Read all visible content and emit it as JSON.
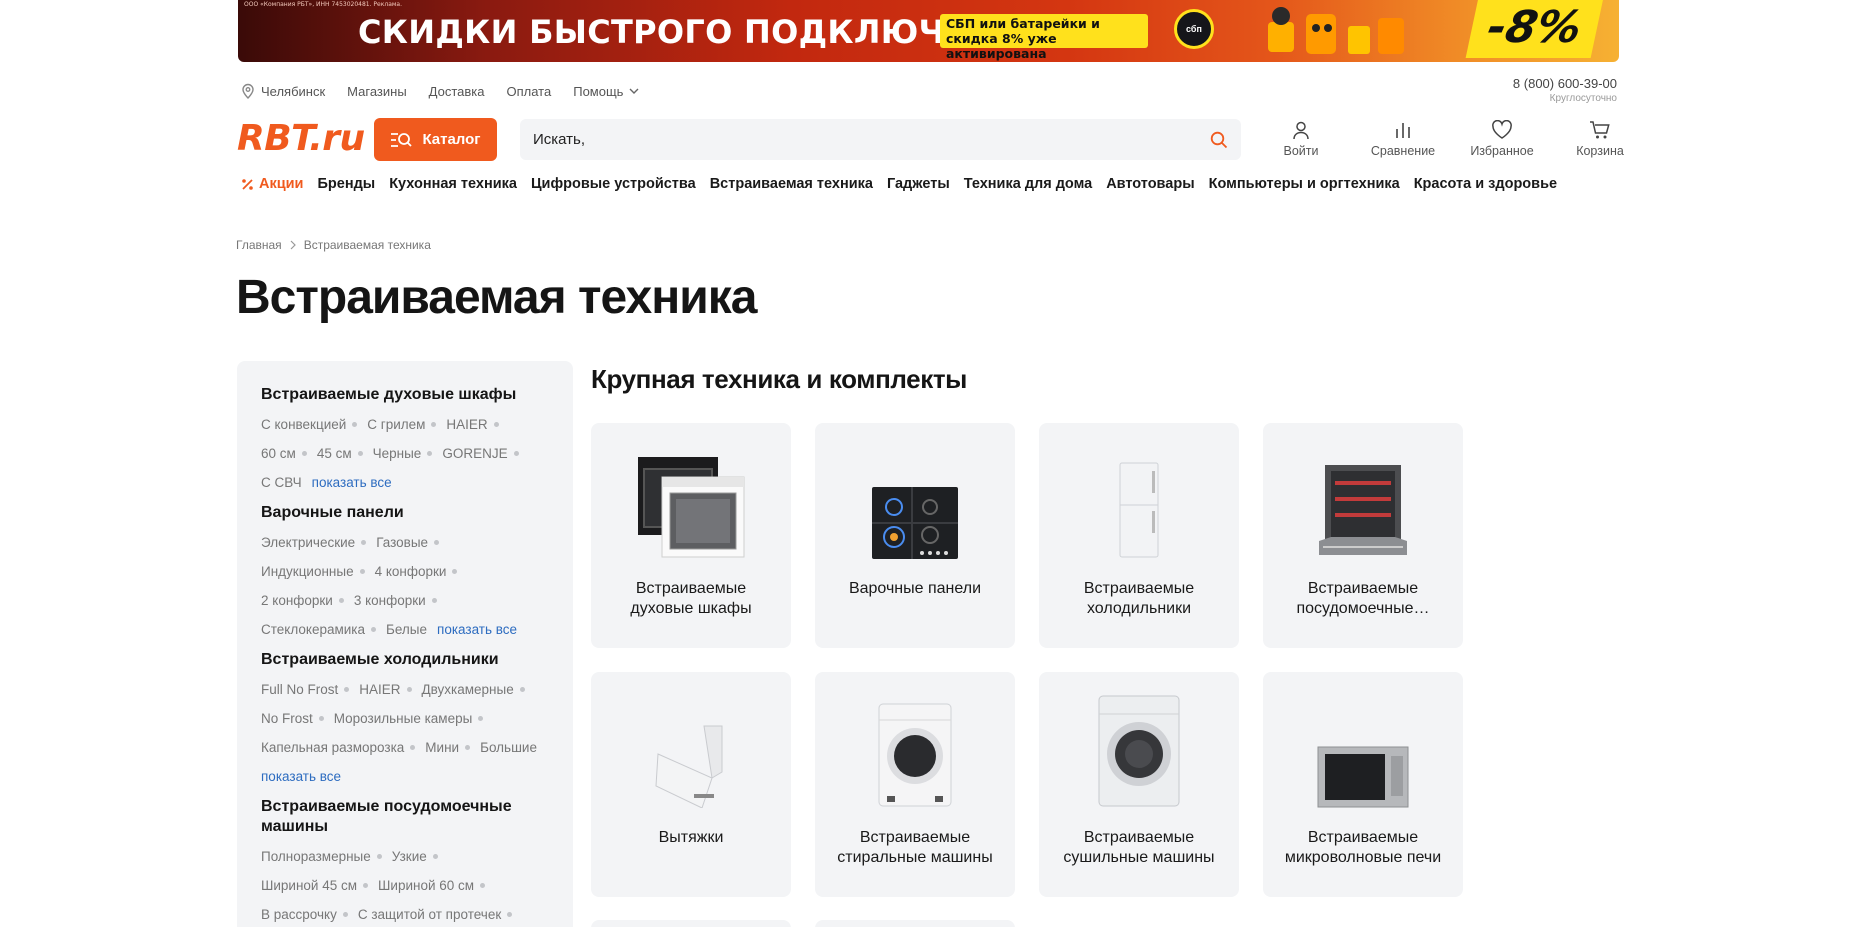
{
  "banner": {
    "legal": "ООО «Компания РБТ», ИНН 7453020481. Реклама.",
    "title": "СКИДКИ БЫСТРОГО ПОДКЛЮЧЕНИЯ",
    "note": "СБП или батарейки и скидка 8% уже активирована",
    "badge": "сбп",
    "discount": "-8%"
  },
  "toplinks": {
    "city": "Челябинск",
    "items": [
      "Магазины",
      "Доставка",
      "Оплата"
    ],
    "help": "Помощь"
  },
  "phone": {
    "number": "8 (800) 600-39-00",
    "hours": "Круглосуточно"
  },
  "header": {
    "logo": "RBT.ru",
    "catalog": "Каталог",
    "search_placeholder": "Искать,",
    "icons": [
      {
        "label": "Войти",
        "icon": "user-icon"
      },
      {
        "label": "Сравнение",
        "icon": "compare-icon"
      },
      {
        "label": "Избранное",
        "icon": "heart-icon"
      },
      {
        "label": "Корзина",
        "icon": "cart-icon"
      }
    ]
  },
  "nav": {
    "promo": "Акции",
    "items": [
      "Бренды",
      "Кухонная техника",
      "Цифровые устройства",
      "Встраиваемая техника",
      "Гаджеты",
      "Техника для дома",
      "Автотовары",
      "Компьютеры и оргтехника",
      "Красота и здоровье"
    ]
  },
  "breadcrumb": [
    "Главная",
    "Встраиваемая техника"
  ],
  "page_title": "Встраиваемая техника",
  "sidebar": {
    "groups": [
      {
        "title": "Встраиваемые духовые шкафы",
        "tags": [
          "С конвекцией",
          "С грилем",
          "HAIER",
          "60 см",
          "45 см",
          "Черные",
          "GORENJE",
          "С СВЧ"
        ],
        "more": "показать все"
      },
      {
        "title": "Варочные панели",
        "tags": [
          "Электрические",
          "Газовые",
          "Индукционные",
          "4 конфорки",
          "2 конфорки",
          "3 конфорки",
          "Стеклокерамика",
          "Белые"
        ],
        "more": "показать все"
      },
      {
        "title": "Встраиваемые холодильники",
        "tags": [
          "Full No Frost",
          "HAIER",
          "Двухкамерные",
          "No Frost",
          "Морозильные камеры",
          "Капельная разморозка",
          "Мини",
          "Большие"
        ],
        "more": "показать все"
      },
      {
        "title": "Встраиваемые посудомоечные машины",
        "tags": [
          "Полноразмерные",
          "Узкие",
          "Шириной 45 см",
          "Шириной 60 см",
          "В рассрочку",
          "С защитой от протечек"
        ],
        "more": ""
      }
    ]
  },
  "section_title": "Крупная техника и комплекты",
  "cards": [
    {
      "label": "Встраиваемые духовые шкафы",
      "icon": "oven-image"
    },
    {
      "label": "Варочные панели",
      "icon": "hob-image"
    },
    {
      "label": "Встраиваемые холодильники",
      "icon": "fridge-image"
    },
    {
      "label": "Встраиваемые посудомоечные…",
      "icon": "dishwasher-image"
    },
    {
      "label": "Вытяжки",
      "icon": "hood-image"
    },
    {
      "label": "Встраиваемые стиральные машины",
      "icon": "washer-image"
    },
    {
      "label": "Встраиваемые сушильные машины",
      "icon": "dryer-image"
    },
    {
      "label": "Встраиваемые микроволновые печи",
      "icon": "microwave-image"
    }
  ],
  "colors": {
    "accent": "#f05a1e",
    "link": "#2d6cc0",
    "card_bg": "#f3f4f6"
  }
}
